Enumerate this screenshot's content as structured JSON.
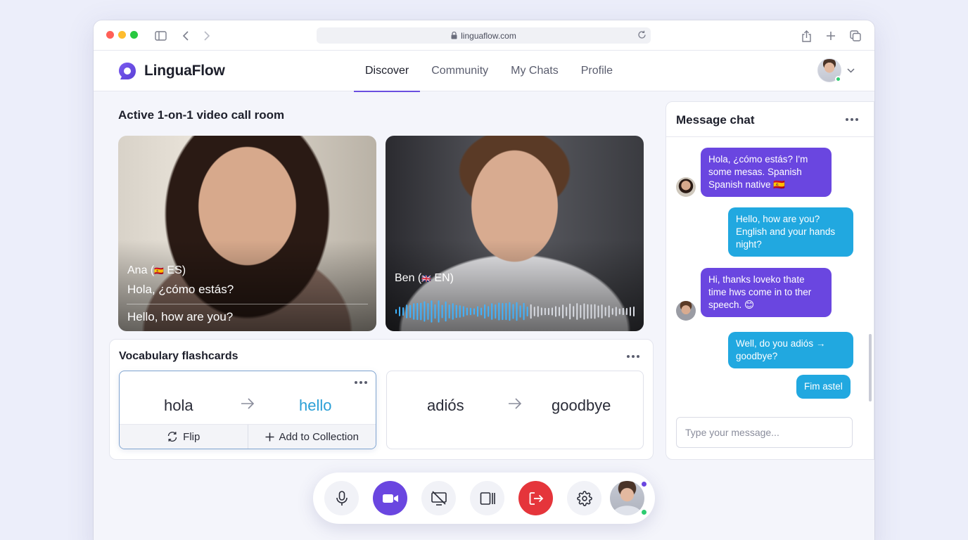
{
  "browser": {
    "url": "linguaflow.com"
  },
  "app": {
    "name": "LinguaFlow",
    "nav": [
      {
        "label": "Discover",
        "active": true
      },
      {
        "label": "Community",
        "active": false
      },
      {
        "label": "My Chats",
        "active": false
      },
      {
        "label": "Profile",
        "active": false
      }
    ],
    "user_status": "online"
  },
  "video_room": {
    "title": "Active 1-on-1 video call room",
    "participants": [
      {
        "name": "Ana",
        "flag": "🇪🇸",
        "lang": "ES",
        "original_line": "Hola, ¿cómo estás?",
        "translated_line": "Hello, how are you?"
      },
      {
        "name": "Ben",
        "flag": "🇬🇧",
        "lang": "EN",
        "speaking": true
      }
    ]
  },
  "flashcards": {
    "title": "Vocabulary flashcards",
    "cards": [
      {
        "word": "hola",
        "translation": "hello",
        "selected": true
      },
      {
        "word": "adiós",
        "translation": "goodbye",
        "selected": false
      }
    ],
    "actions": {
      "flip": "Flip",
      "add": "Add to Collection"
    }
  },
  "chat": {
    "title": "Message chat",
    "messages": [
      {
        "from": "Ana",
        "direction": "in",
        "text": "Hola, ¿cómo estás? I'm some mesas. Spanish Spanish native 🇪🇸"
      },
      {
        "from": "me",
        "direction": "out",
        "text": "Hello, how are you? English and your hands night?"
      },
      {
        "from": "Ben",
        "direction": "in",
        "text": "Hi, thanks loveko thate time hws come in to ther speech. 😊"
      },
      {
        "from": "me",
        "direction": "out",
        "text": "Well, do you adiós → goodbye?"
      },
      {
        "from": "me",
        "direction": "out",
        "text": "Fim astel"
      }
    ],
    "input_placeholder": "Type your message..."
  },
  "controls": [
    {
      "name": "microphone",
      "icon": "mic-icon"
    },
    {
      "name": "camera",
      "icon": "video-camera-icon",
      "active": true
    },
    {
      "name": "screen-share",
      "icon": "screen-share-off-icon"
    },
    {
      "name": "layout",
      "icon": "split-view-icon"
    },
    {
      "name": "leave",
      "icon": "leave-call-icon"
    },
    {
      "name": "settings",
      "icon": "gear-icon"
    }
  ],
  "colors": {
    "primary": "#6a46e0",
    "accent": "#21a8e0",
    "danger": "#e5353b",
    "online": "#2ecc71"
  }
}
